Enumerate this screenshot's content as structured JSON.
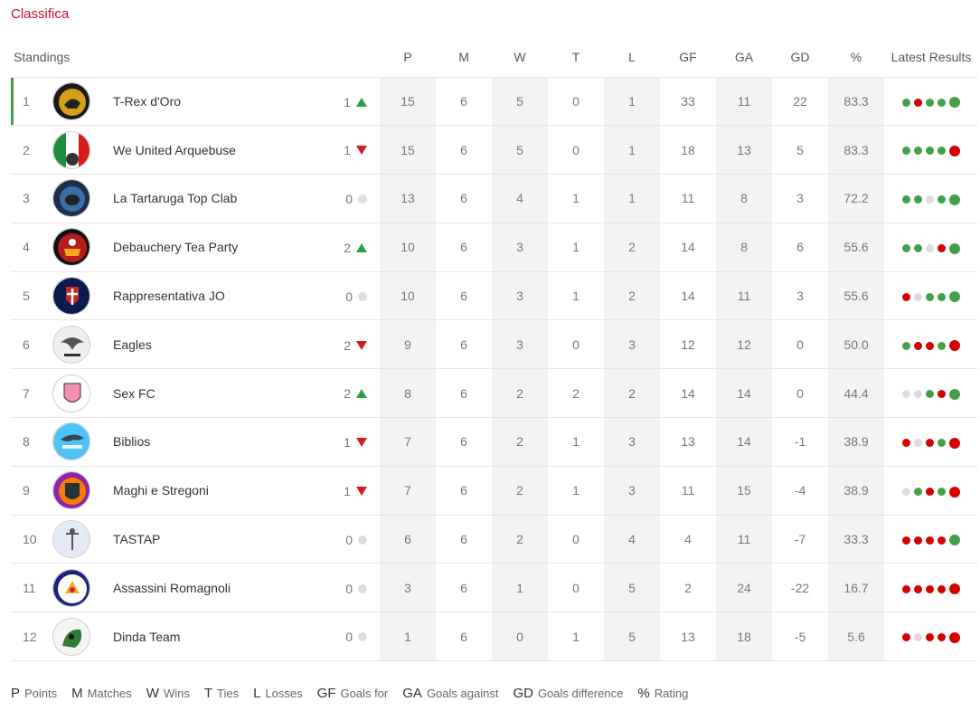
{
  "page_title": "Classifica",
  "columns": {
    "standings": "Standings",
    "p": "P",
    "m": "M",
    "w": "W",
    "t": "T",
    "l": "L",
    "gf": "GF",
    "ga": "GA",
    "gd": "GD",
    "pct": "%",
    "latest": "Latest Results"
  },
  "colors": {
    "accent_red": "#c8102e",
    "win": "#43a047",
    "loss": "#d50000",
    "tie": "#dcdcdc",
    "leader_bar": "#43a047"
  },
  "teams": [
    {
      "pos": "1",
      "name": "T-Rex d'Oro",
      "logo": "trex-logo",
      "move": "1",
      "dir": "up",
      "p": "15",
      "m": "6",
      "w": "5",
      "t": "0",
      "l": "1",
      "gf": "33",
      "ga": "11",
      "gd": "22",
      "pct": "83.3",
      "results": [
        "W",
        "L",
        "W",
        "W",
        "W"
      ]
    },
    {
      "pos": "2",
      "name": "We United Arquebuse",
      "logo": "we-united-logo",
      "move": "1",
      "dir": "down",
      "p": "15",
      "m": "6",
      "w": "5",
      "t": "0",
      "l": "1",
      "gf": "18",
      "ga": "13",
      "gd": "5",
      "pct": "83.3",
      "results": [
        "W",
        "W",
        "W",
        "W",
        "L"
      ]
    },
    {
      "pos": "3",
      "name": "La Tartaruga Top Clab",
      "logo": "tartaruga-logo",
      "move": "0",
      "dir": "same",
      "p": "13",
      "m": "6",
      "w": "4",
      "t": "1",
      "l": "1",
      "gf": "11",
      "ga": "8",
      "gd": "3",
      "pct": "72.2",
      "results": [
        "W",
        "W",
        "T",
        "W",
        "W"
      ]
    },
    {
      "pos": "4",
      "name": "Debauchery Tea Party",
      "logo": "debauchery-logo",
      "move": "2",
      "dir": "up",
      "p": "10",
      "m": "6",
      "w": "3",
      "t": "1",
      "l": "2",
      "gf": "14",
      "ga": "8",
      "gd": "6",
      "pct": "55.6",
      "results": [
        "W",
        "W",
        "T",
        "L",
        "W"
      ]
    },
    {
      "pos": "5",
      "name": "Rappresentativa JO",
      "logo": "rappresentativa-logo",
      "move": "0",
      "dir": "same",
      "p": "10",
      "m": "6",
      "w": "3",
      "t": "1",
      "l": "2",
      "gf": "14",
      "ga": "11",
      "gd": "3",
      "pct": "55.6",
      "results": [
        "L",
        "T",
        "W",
        "W",
        "W"
      ]
    },
    {
      "pos": "6",
      "name": "Eagles",
      "logo": "eagles-logo",
      "move": "2",
      "dir": "down",
      "p": "9",
      "m": "6",
      "w": "3",
      "t": "0",
      "l": "3",
      "gf": "12",
      "ga": "12",
      "gd": "0",
      "pct": "50.0",
      "results": [
        "W",
        "L",
        "L",
        "W",
        "L"
      ]
    },
    {
      "pos": "7",
      "name": "Sex FC",
      "logo": "sexfc-logo",
      "move": "2",
      "dir": "up",
      "p": "8",
      "m": "6",
      "w": "2",
      "t": "2",
      "l": "2",
      "gf": "14",
      "ga": "14",
      "gd": "0",
      "pct": "44.4",
      "results": [
        "T",
        "T",
        "W",
        "L",
        "W"
      ]
    },
    {
      "pos": "8",
      "name": "Biblios",
      "logo": "biblios-logo",
      "move": "1",
      "dir": "down",
      "p": "7",
      "m": "6",
      "w": "2",
      "t": "1",
      "l": "3",
      "gf": "13",
      "ga": "14",
      "gd": "-1",
      "pct": "38.9",
      "results": [
        "L",
        "T",
        "L",
        "W",
        "L"
      ]
    },
    {
      "pos": "9",
      "name": "Maghi e Stregoni",
      "logo": "maghi-logo",
      "move": "1",
      "dir": "down",
      "p": "7",
      "m": "6",
      "w": "2",
      "t": "1",
      "l": "3",
      "gf": "11",
      "ga": "15",
      "gd": "-4",
      "pct": "38.9",
      "results": [
        "T",
        "W",
        "L",
        "W",
        "L"
      ]
    },
    {
      "pos": "10",
      "name": "TASTAP",
      "logo": "tastap-logo",
      "move": "0",
      "dir": "same",
      "p": "6",
      "m": "6",
      "w": "2",
      "t": "0",
      "l": "4",
      "gf": "4",
      "ga": "11",
      "gd": "-7",
      "pct": "33.3",
      "results": [
        "L",
        "L",
        "L",
        "L",
        "W"
      ]
    },
    {
      "pos": "11",
      "name": "Assassini Romagnoli",
      "logo": "assassini-logo",
      "move": "0",
      "dir": "same",
      "p": "3",
      "m": "6",
      "w": "1",
      "t": "0",
      "l": "5",
      "gf": "2",
      "ga": "24",
      "gd": "-22",
      "pct": "16.7",
      "results": [
        "L",
        "L",
        "L",
        "L",
        "L"
      ]
    },
    {
      "pos": "12",
      "name": "Dinda Team",
      "logo": "dinda-logo",
      "move": "0",
      "dir": "same",
      "p": "1",
      "m": "6",
      "w": "0",
      "t": "1",
      "l": "5",
      "gf": "13",
      "ga": "18",
      "gd": "-5",
      "pct": "5.6",
      "results": [
        "L",
        "T",
        "L",
        "L",
        "L"
      ]
    }
  ],
  "legend": [
    {
      "abbr": "P",
      "desc": "Points"
    },
    {
      "abbr": "M",
      "desc": "Matches"
    },
    {
      "abbr": "W",
      "desc": "Wins"
    },
    {
      "abbr": "T",
      "desc": "Ties"
    },
    {
      "abbr": "L",
      "desc": "Losses"
    },
    {
      "abbr": "GF",
      "desc": "Goals for"
    },
    {
      "abbr": "GA",
      "desc": "Goals against"
    },
    {
      "abbr": "GD",
      "desc": "Goals difference"
    },
    {
      "abbr": "%",
      "desc": "Rating"
    }
  ]
}
